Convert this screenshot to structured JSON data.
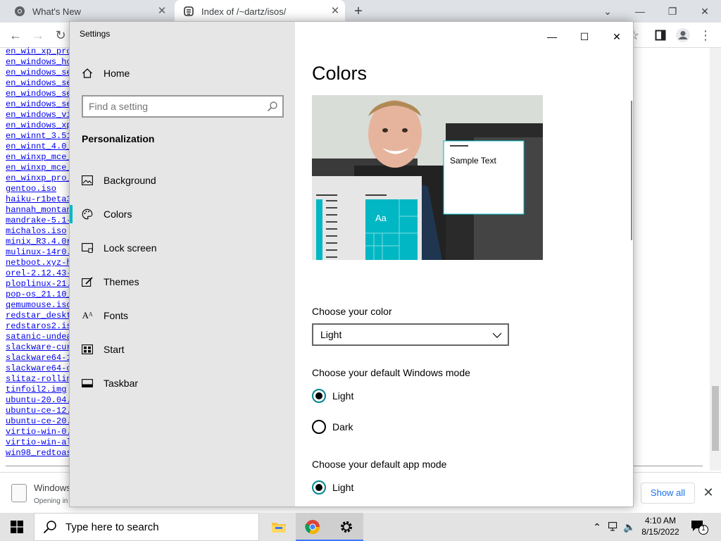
{
  "browser": {
    "tabs": [
      {
        "label": "What's New"
      },
      {
        "label": "Index of /~dartz/isos/"
      }
    ]
  },
  "listing": [
    "en_win_xp_pro",
    "en_windows_ho",
    "en_windows_se",
    "en_windows_se",
    "en_windows_se",
    "en_windows_se",
    "en_windows_vi",
    "en_windows_xp",
    "en_winnt_3.51",
    "en_winnt_4.0_",
    "en_winxp_mce_",
    "en_winxp_mce_",
    "en_winxp_pro_",
    "gentoo.iso",
    "haiku-r1beta3",
    "hannah_montan",
    "mandrake-5.1-",
    "michalos.iso",
    "minix_R3.4.0r",
    "mulinux-14r0.",
    "netboot.xyz-h",
    "orel-2.12.43-",
    "ploplinux-21.",
    "pop-os_21.10_",
    "qemumouse.iso",
    "redstar_deskt",
    "redstaros2.is",
    "satanic-undea",
    "slackware-cur",
    "slackware64-1",
    "slackware64-c",
    "slitaz-rollin",
    "tinfoil2.img",
    "ubuntu-20.04.",
    "ubuntu-ce-12.",
    "ubuntu-ce-20.",
    "virtio-win-0.",
    "virtio-win-al",
    "win98_redtoas"
  ],
  "downloads": {
    "file_name": "Windows",
    "status": "Opening in",
    "show_all": "Show all"
  },
  "settings": {
    "window_title": "Settings",
    "home": "Home",
    "search_placeholder": "Find a setting",
    "section": "Personalization",
    "nav": [
      {
        "label": "Background",
        "icon": "picture-icon"
      },
      {
        "label": "Colors",
        "icon": "palette-icon"
      },
      {
        "label": "Lock screen",
        "icon": "lock-screen-icon"
      },
      {
        "label": "Themes",
        "icon": "brush-icon"
      },
      {
        "label": "Fonts",
        "icon": "fonts-icon"
      },
      {
        "label": "Start",
        "icon": "start-layout-icon"
      },
      {
        "label": "Taskbar",
        "icon": "taskbar-icon"
      }
    ],
    "selected_nav": "Colors",
    "heading": "Colors",
    "preview": {
      "sample_text": "Sample Text",
      "tile_text": "Aa"
    },
    "choose_color_label": "Choose your color",
    "choose_color_value": "Light",
    "windows_mode_label": "Choose your default Windows mode",
    "windows_mode_options": [
      "Light",
      "Dark"
    ],
    "windows_mode_selected": "Light",
    "app_mode_label": "Choose your default app mode",
    "app_mode_options": [
      "Light"
    ],
    "app_mode_selected": "Light",
    "accent_color": "#00b7c3"
  },
  "taskbar": {
    "search_placeholder": "Type here to search",
    "time": "4:10 AM",
    "date": "8/15/2022",
    "notification_count": "1"
  }
}
